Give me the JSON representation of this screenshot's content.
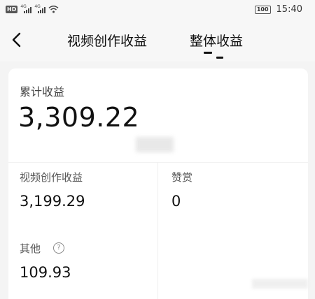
{
  "status_bar": {
    "hd_badge": "HD",
    "battery": "100",
    "time": "15:40"
  },
  "header": {
    "tabs": [
      {
        "label": "视频创作收益",
        "active": false
      },
      {
        "label": "整体收益",
        "active": true
      }
    ]
  },
  "earnings": {
    "total_label": "累计收益",
    "total_value": "3,309.22",
    "items": [
      {
        "label": "视频创作收益",
        "value": "3,199.29"
      },
      {
        "label": "赞赏",
        "value": "0"
      },
      {
        "label": "其他",
        "value": "109.93"
      }
    ]
  },
  "icons": {
    "back": "chevron-left-icon",
    "help": "question-circle-icon",
    "wifi": "wifi-icon",
    "signal": "signal-icon"
  }
}
